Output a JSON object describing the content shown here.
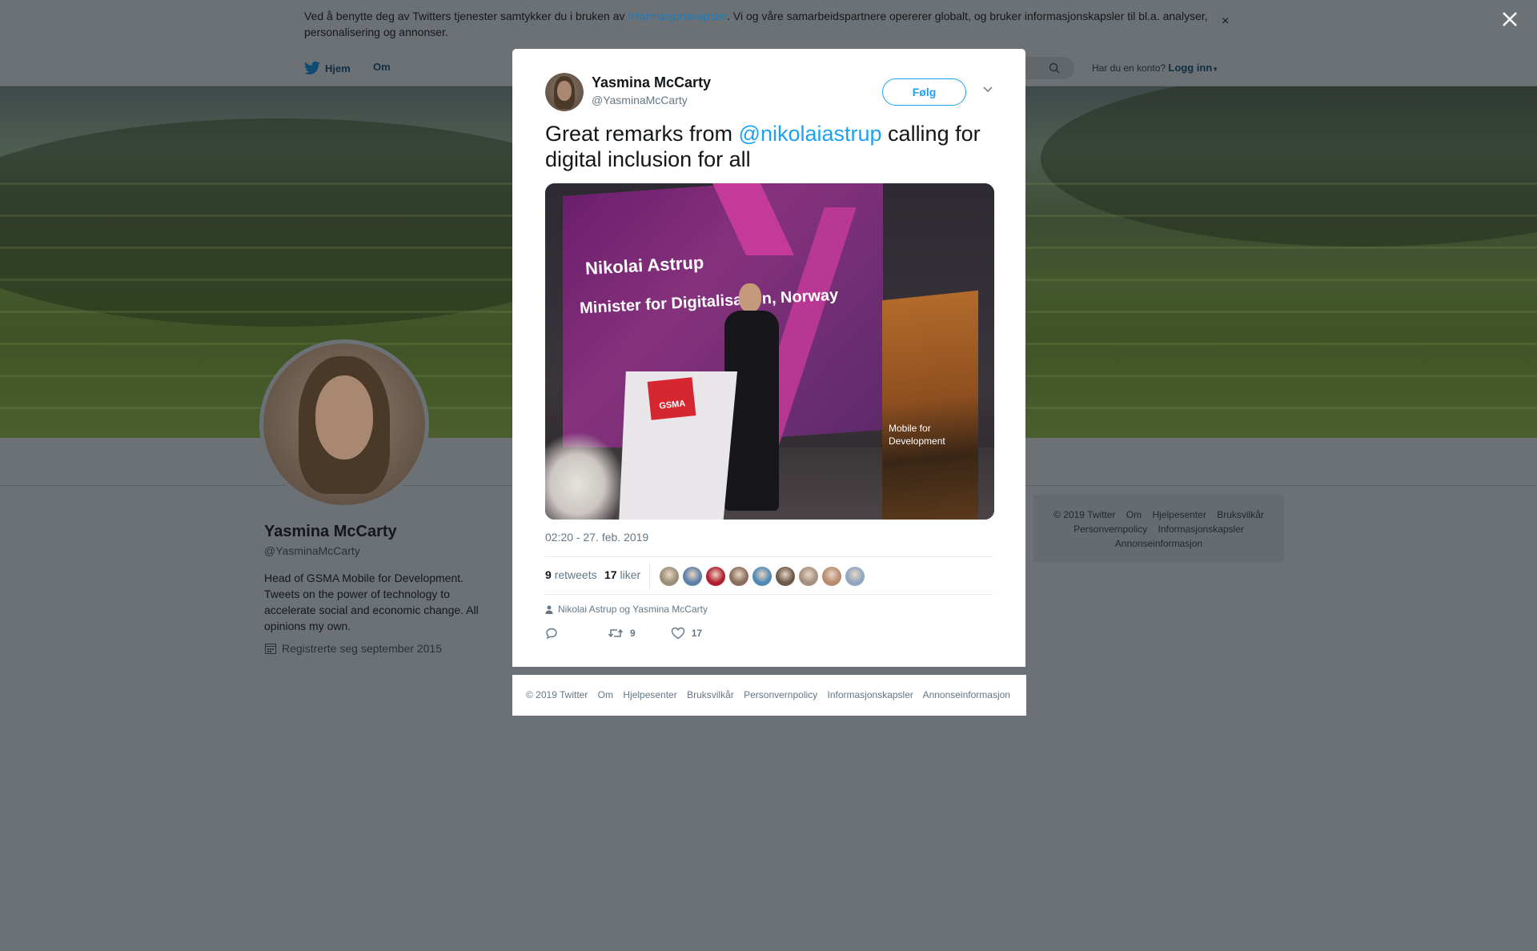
{
  "cookie_banner": {
    "text_before": "Ved å benytte deg av Twitters tjenester samtykker du i bruken av ",
    "link": "informasjonskapsler",
    "text_after": ". Vi og våre samarbeidspartnere opererer globalt, og bruker informasjonskapsler til bl.a. analyser, personalisering og annonser.",
    "close": "×"
  },
  "nav": {
    "home": "Hjem",
    "about": "Om",
    "account_prompt": "Har du en konto?",
    "login": "Logg inn"
  },
  "profile": {
    "name": "Yasmina McCarty",
    "handle": "@YasminaMcCarty",
    "bio": "Head of GSMA Mobile for Development. Tweets on the power of technology to accelerate social and economic change. All opinions my own.",
    "joined": "Registrerte seg september 2015"
  },
  "side_footer": {
    "line1": [
      "© 2019 Twitter",
      "Om",
      "Hjelpesenter",
      "Bruksvilkår"
    ],
    "line2": [
      "Personvernpolicy",
      "Informasjonskapsler"
    ],
    "line3": [
      "Annonseinformasjon"
    ]
  },
  "tweet": {
    "author_name": "Yasmina McCarty",
    "author_handle": "@YasminaMcCarty",
    "follow_label": "Følg",
    "text_before": "Great remarks from ",
    "mention": "@nikolaiastrup",
    "text_after": " calling for digital inclusion for all",
    "photo": {
      "line1": "Nikolai Astrup",
      "line2": "Minister for Digitalisation, Norway",
      "lectern_logo": "GSMA",
      "banner_line1": "Mobile for",
      "banner_line2": "Development"
    },
    "timestamp": "02:20 - 27. feb. 2019",
    "retweets_count": "9",
    "retweets_label": "retweets",
    "likes_count": "17",
    "likes_label": "liker",
    "likers_colors": [
      "#9a8f78",
      "#5d7fa8",
      "#b01f2e",
      "#8a6d5c",
      "#4f88b5",
      "#6b5848",
      "#a58f7e",
      "#b88a6e",
      "#8fa5c0"
    ],
    "reply_to": "Nikolai Astrup og Yasmina McCarty",
    "action_retweet_count": "9",
    "action_like_count": "17"
  },
  "modal_footer": [
    "© 2019 Twitter",
    "Om",
    "Hjelpesenter",
    "Bruksvilkår",
    "Personvernpolicy",
    "Informasjonskapsler",
    "Annonseinformasjon"
  ],
  "colors": {
    "accent": "#1da1f2",
    "muted": "#657786",
    "overlay": "#6b7177"
  }
}
